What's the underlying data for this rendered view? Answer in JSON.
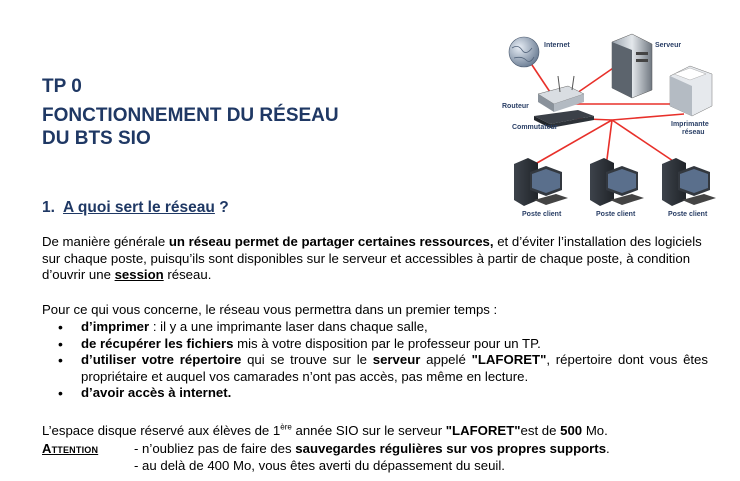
{
  "heading": {
    "tp": "TP 0",
    "title_line1": "FONCTIONNEMENT DU RÉSEAU",
    "title_line2": "DU BTS SIO"
  },
  "section1": {
    "number": "1.",
    "title": "A quoi sert le réseau",
    "suffix": " ?"
  },
  "paragraph1": {
    "t1": "De manière générale ",
    "b1": "un réseau permet de partager certaines ressources,",
    "t2": " et d’éviter l’installation des logiciels sur chaque poste, puisqu’ils sont disponibles sur le serveur et accessibles à partir de chaque poste, à condition d’ouvrir une ",
    "bu1": "session",
    "t3": " réseau."
  },
  "paragraph2": "Pour ce qui vous concerne, le réseau vous permettra dans un premier temps :",
  "bullets": [
    {
      "b": "d’imprimer",
      "t": " : il y a une imprimante laser dans chaque salle,"
    },
    {
      "b": "de récupérer les fichiers",
      "t": " mis à votre disposition par le professeur pour un TP."
    },
    {
      "b": "d’utiliser votre répertoire",
      "t1": " qui se trouve sur le ",
      "b2": "serveur",
      "t2": " appelé ",
      "b3": "\"LAFORET\"",
      "t3": ", répertoire dont vous êtes propriétaire et auquel vos camarades n’ont pas accès, pas même en lecture."
    },
    {
      "b": "d’avoir accès à internet."
    }
  ],
  "paragraph3": {
    "t1": "L’espace disque réservé aux élèves de 1",
    "sup": "ère",
    "t2": " année SIO sur le serveur ",
    "b1": "\"LAFORET\"",
    "t3": "est de ",
    "b2": "500",
    "t4": " Mo."
  },
  "attention": {
    "label": "Attention",
    "line1_t": "- n’oubliez pas de faire des ",
    "line1_b": "sauvegardes régulières sur vos propres supports",
    "line1_end": ".",
    "line2": "- au delà de 400 Mo, vous êtes averti du dépassement du seuil."
  },
  "diagram": {
    "labels": {
      "internet": "Internet",
      "server": "Serveur",
      "router": "Routeur",
      "switch": "Commutateur",
      "printer_1": "Imprimante",
      "printer_2": "réseau",
      "client": "Poste client"
    },
    "cable_color": "#e8302a"
  }
}
